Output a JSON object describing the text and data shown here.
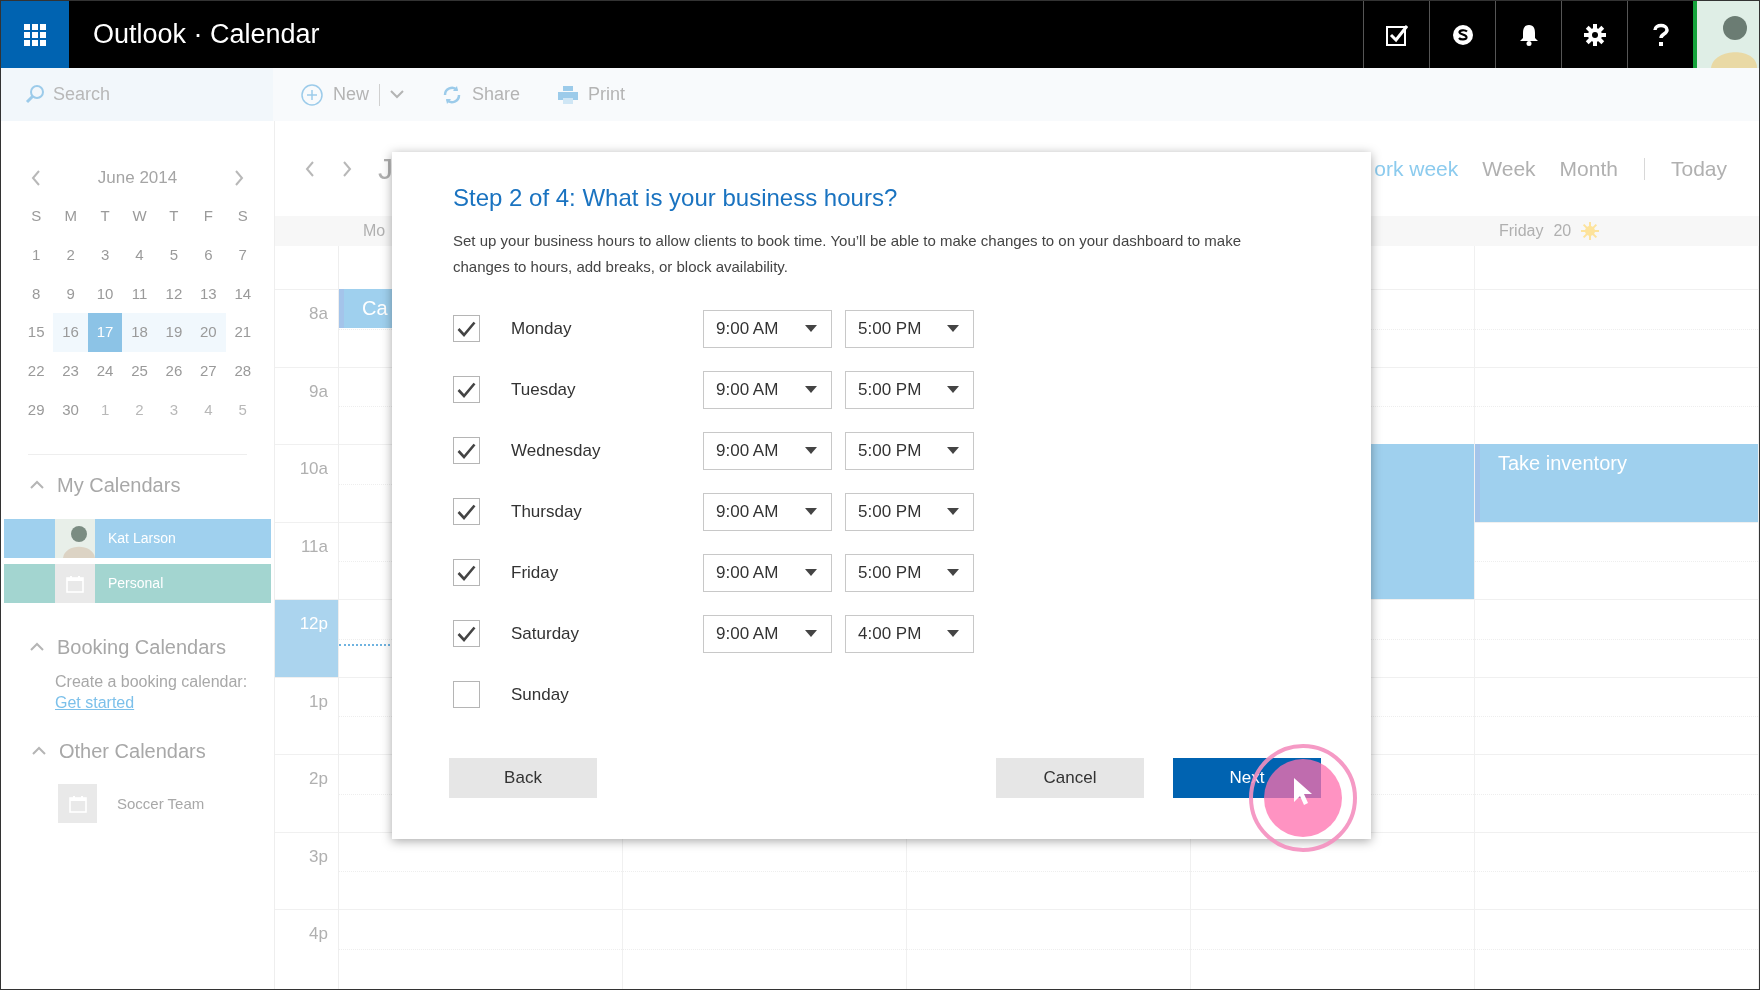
{
  "app_bar": {
    "title": "Outlook · Calendar"
  },
  "toolbar": {
    "search": {
      "placeholder": "Search"
    },
    "actions": [
      {
        "kind": "new",
        "label": "New"
      },
      {
        "kind": "share",
        "label": "Share"
      },
      {
        "kind": "print",
        "label": "Print"
      }
    ]
  },
  "mini_calendar": {
    "month": "June 2014",
    "weekdays": [
      "S",
      "M",
      "T",
      "W",
      "T",
      "F",
      "S"
    ],
    "weeks": [
      [
        {
          "day": "1",
          "in_range": false,
          "selected": false,
          "other_month": false
        },
        {
          "day": "2",
          "in_range": false,
          "selected": false,
          "other_month": false
        },
        {
          "day": "3",
          "in_range": false,
          "selected": false,
          "other_month": false
        },
        {
          "day": "4",
          "in_range": false,
          "selected": false,
          "other_month": false
        },
        {
          "day": "5",
          "in_range": false,
          "selected": false,
          "other_month": false
        },
        {
          "day": "6",
          "in_range": false,
          "selected": false,
          "other_month": false
        },
        {
          "day": "7",
          "in_range": false,
          "selected": false,
          "other_month": false
        }
      ],
      [
        {
          "day": "8",
          "in_range": false,
          "selected": false,
          "other_month": false
        },
        {
          "day": "9",
          "in_range": false,
          "selected": false,
          "other_month": false
        },
        {
          "day": "10",
          "in_range": false,
          "selected": false,
          "other_month": false
        },
        {
          "day": "11",
          "in_range": false,
          "selected": false,
          "other_month": false
        },
        {
          "day": "12",
          "in_range": false,
          "selected": false,
          "other_month": false
        },
        {
          "day": "13",
          "in_range": false,
          "selected": false,
          "other_month": false
        },
        {
          "day": "14",
          "in_range": false,
          "selected": false,
          "other_month": false
        }
      ],
      [
        {
          "day": "15",
          "in_range": false,
          "selected": false,
          "other_month": false
        },
        {
          "day": "16",
          "in_range": true,
          "selected": false,
          "other_month": false
        },
        {
          "day": "17",
          "in_range": true,
          "selected": true,
          "other_month": false
        },
        {
          "day": "18",
          "in_range": true,
          "selected": false,
          "other_month": false
        },
        {
          "day": "19",
          "in_range": true,
          "selected": false,
          "other_month": false
        },
        {
          "day": "20",
          "in_range": true,
          "selected": false,
          "other_month": false
        },
        {
          "day": "21",
          "in_range": false,
          "selected": false,
          "other_month": false
        }
      ],
      [
        {
          "day": "22",
          "in_range": false,
          "selected": false,
          "other_month": false
        },
        {
          "day": "23",
          "in_range": false,
          "selected": false,
          "other_month": false
        },
        {
          "day": "24",
          "in_range": false,
          "selected": false,
          "other_month": false
        },
        {
          "day": "25",
          "in_range": false,
          "selected": false,
          "other_month": false
        },
        {
          "day": "26",
          "in_range": false,
          "selected": false,
          "other_month": false
        },
        {
          "day": "27",
          "in_range": false,
          "selected": false,
          "other_month": false
        },
        {
          "day": "28",
          "in_range": false,
          "selected": false,
          "other_month": false
        }
      ],
      [
        {
          "day": "29",
          "in_range": false,
          "selected": false,
          "other_month": false
        },
        {
          "day": "30",
          "in_range": false,
          "selected": false,
          "other_month": false
        },
        {
          "day": "1",
          "in_range": false,
          "selected": false,
          "other_month": true
        },
        {
          "day": "2",
          "in_range": false,
          "selected": false,
          "other_month": true
        },
        {
          "day": "3",
          "in_range": false,
          "selected": false,
          "other_month": true
        },
        {
          "day": "4",
          "in_range": false,
          "selected": false,
          "other_month": true
        },
        {
          "day": "5",
          "in_range": false,
          "selected": false,
          "other_month": true
        }
      ]
    ]
  },
  "my_calendars": {
    "title": "My Calendars",
    "expanded": true,
    "items": [
      {
        "name": "Kat Larson",
        "kind": "photo",
        "color": "#9fd0ee"
      },
      {
        "name": "Personal",
        "kind": "calendar",
        "color": "#a3d5d0"
      }
    ]
  },
  "booking_calendars": {
    "title": "Booking Calendars",
    "expanded": true,
    "text": "Create a booking calendar:",
    "link": "Get started"
  },
  "other_calendars": {
    "title": "Other Calendars",
    "expanded": true,
    "items": [
      {
        "name": "Soccer Team"
      }
    ]
  },
  "calendar": {
    "title": "J",
    "view_tabs": [
      {
        "label": "ork week",
        "selected": true
      },
      {
        "label": "Week",
        "selected": false
      },
      {
        "label": "Month",
        "selected": false
      }
    ],
    "today": "Today",
    "hours": [
      {
        "label": "8a",
        "selected": false
      },
      {
        "label": "9a",
        "selected": false
      },
      {
        "label": "10a",
        "selected": false
      },
      {
        "label": "11a",
        "selected": false
      },
      {
        "label": "12p",
        "selected": true
      },
      {
        "label": "1p",
        "selected": false
      },
      {
        "label": "2p",
        "selected": false
      },
      {
        "label": "3p",
        "selected": false
      },
      {
        "label": "4p",
        "selected": false
      }
    ],
    "day_columns": [
      {
        "header": "Mo",
        "events": [
          {
            "kind": "appointment",
            "title": "Ca"
          }
        ]
      },
      {},
      {},
      {
        "events": [
          {
            "kind": "appointment"
          }
        ]
      },
      {
        "header": "Friday",
        "date": "20",
        "events": [
          {
            "kind": "appointment",
            "title": "Take inventory"
          }
        ]
      }
    ]
  },
  "dialog": {
    "title": "Step 2 of 4: What is your business hours?",
    "description": "Set up your business hours to allow clients to book time. You’ll be able to make changes to on your dashboard to make changes to hours, add breaks, or block availability.",
    "days": [
      {
        "name": "Monday",
        "checked": true,
        "start": "9:00 AM",
        "end": "5:00 PM"
      },
      {
        "name": "Tuesday",
        "checked": true,
        "start": "9:00 AM",
        "end": "5:00 PM"
      },
      {
        "name": "Wednesday",
        "checked": true,
        "start": "9:00 AM",
        "end": "5:00 PM"
      },
      {
        "name": "Thursday",
        "checked": true,
        "start": "9:00 AM",
        "end": "5:00 PM"
      },
      {
        "name": "Friday",
        "checked": true,
        "start": "9:00 AM",
        "end": "5:00 PM"
      },
      {
        "name": "Saturday",
        "checked": true,
        "start": "9:00 AM",
        "end": "4:00 PM"
      },
      {
        "name": "Sunday",
        "checked": false
      }
    ],
    "back": "Back",
    "cancel": "Cancel",
    "next": "Next"
  }
}
